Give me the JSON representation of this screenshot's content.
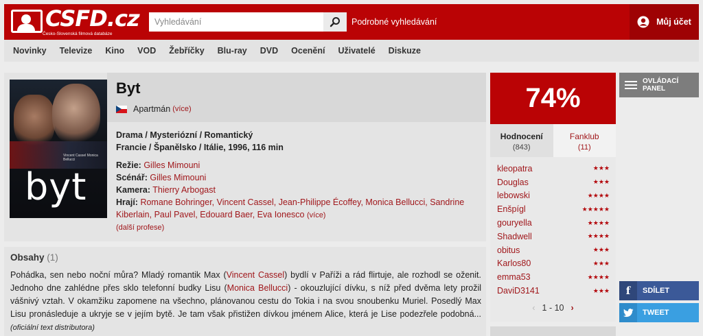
{
  "header": {
    "logo_text": "CSFD.cz",
    "logo_subtitle": "Česko-Slovenská filmová databáze",
    "search_placeholder": "Vyhledávání",
    "advanced_search": "Podrobné vyhledávání",
    "account": "Můj účet"
  },
  "nav": [
    "Novinky",
    "Televize",
    "Kino",
    "VOD",
    "Žebříčky",
    "Blu-ray",
    "DVD",
    "Ocenění",
    "Uživatelé",
    "Diskuze"
  ],
  "film": {
    "title": "Byt",
    "alt_title": "Apartmán",
    "alt_more": "(více)",
    "genres": "Drama / Mysteriózní / Romantický",
    "origin": "Francie / Španělsko / Itálie, 1996, 116 min",
    "poster_title": "byt",
    "poster_names": "Vincent Cassel Monica Bellucci",
    "credits": {
      "director_label": "Režie:",
      "director": "Gilles Mimouni",
      "writer_label": "Scénář:",
      "writer": "Gilles Mimouni",
      "camera_label": "Kamera:",
      "camera": "Thierry Arbogast",
      "cast_label": "Hrají:",
      "cast": "Romane Bohringer, Vincent Cassel, Jean-Philippe Écoffey, Monica Bellucci, Sandrine Kiberlain, Paul Pavel, Edouard Baer, Eva Ionesco",
      "cast_more": "(více)"
    },
    "more_professions": "(další profese)"
  },
  "plot": {
    "heading": "Obsahy",
    "count": "(1)",
    "t1": "Pohádka, sen nebo noční můra? Mladý romantik Max (",
    "l1": "Vincent Cassel",
    "t2": ") bydlí v Paříži a rád flirtuje, ale rozhodl se oženit. Jednoho dne zahlédne přes sklo telefonní budky Lisu (",
    "l2": "Monica Bellucci",
    "t3": ") - okouzlující dívku, s níž před dvěma lety prožil vášnivý vztah. V okamžiku zapomene na všechno, plánovanou cestu do Tokia i na svou snoubenku Muriel. Posedlý Max Lisu pronásleduje a ukryje se v jejím bytě. Je tam však přistižen dívkou jménem Alice, která je Lise podezřele podobná...",
    "source": "(oficiální text distributora)"
  },
  "rating": {
    "percent": "74%",
    "tab_ratings": "Hodnocení",
    "tab_ratings_count": "(843)",
    "tab_fanclub": "Fanklub",
    "tab_fanclub_count": "(11)",
    "users": [
      {
        "name": "kleopatra",
        "stars": "★★★"
      },
      {
        "name": "Douglas",
        "stars": "★★★"
      },
      {
        "name": "lebowski",
        "stars": "★★★★"
      },
      {
        "name": "Enšpígl",
        "stars": "★★★★★"
      },
      {
        "name": "gouryella",
        "stars": "★★★★"
      },
      {
        "name": "Shadwell",
        "stars": "★★★★"
      },
      {
        "name": "obitus",
        "stars": "★★★"
      },
      {
        "name": "Karlos80",
        "stars": "★★★"
      },
      {
        "name": "emma53",
        "stars": "★★★★"
      },
      {
        "name": "DaviD3141",
        "stars": "★★★"
      }
    ],
    "pager": "1 - 10"
  },
  "panel": {
    "control_panel": "OVLÁDACÍ PANEL",
    "share": "SDÍLET",
    "tweet": "TWEET"
  },
  "colors": {
    "brand": "#ba0305",
    "link": "#a0171b",
    "facebook": "#3b5998",
    "twitter": "#3a9fe1"
  }
}
